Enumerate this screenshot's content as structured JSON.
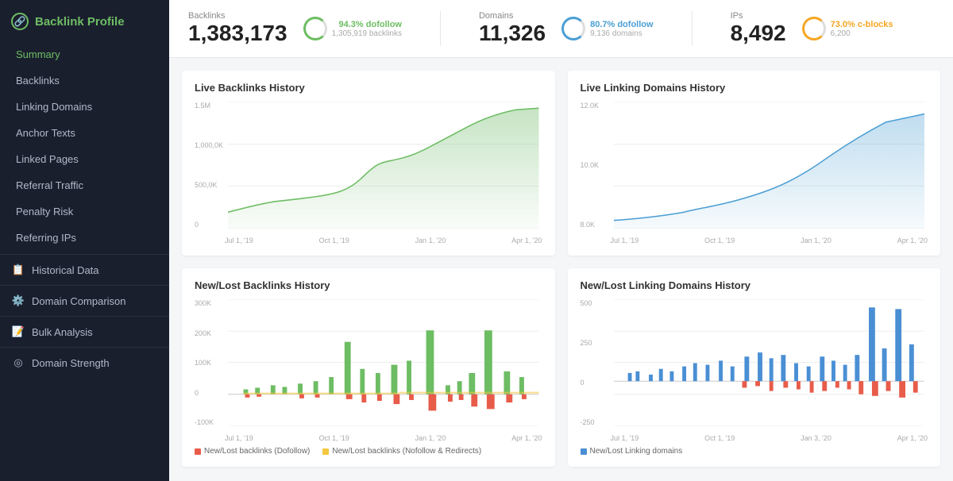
{
  "sidebar": {
    "logo_text": "Backlink Profile",
    "items": [
      {
        "label": "Summary",
        "active": true
      },
      {
        "label": "Backlinks",
        "active": false
      },
      {
        "label": "Linking Domains",
        "active": false
      },
      {
        "label": "Anchor Texts",
        "active": false
      },
      {
        "label": "Linked Pages",
        "active": false
      },
      {
        "label": "Referral Traffic",
        "active": false
      },
      {
        "label": "Penalty Risk",
        "active": false
      },
      {
        "label": "Referring IPs",
        "active": false
      }
    ],
    "sections": [
      {
        "label": "Historical Data",
        "icon": "📋"
      },
      {
        "label": "Domain Comparison",
        "icon": "⚙"
      },
      {
        "label": "Bulk Analysis",
        "icon": "📝"
      },
      {
        "label": "Domain Strength",
        "icon": "◎"
      }
    ]
  },
  "stats": {
    "backlinks": {
      "label": "Backlinks",
      "value": "1,383,173",
      "badge": "94.3% dofollow",
      "subtext": "1,305,919 backlinks",
      "circle_color": "green"
    },
    "domains": {
      "label": "Domains",
      "value": "11,326",
      "badge": "80.7% dofollow",
      "subtext": "9,136 domains",
      "circle_color": "blue"
    },
    "ips": {
      "label": "IPs",
      "value": "8,492",
      "badge": "73.0% c-blocks",
      "subtext": "6,200",
      "circle_color": "orange"
    }
  },
  "charts": {
    "live_backlinks": {
      "title": "Live Backlinks History",
      "y_labels": [
        "1.5M",
        "1,000,0K",
        "500,0K",
        "0"
      ],
      "x_labels": [
        "Jul 1, '19",
        "Oct 1, '19",
        "Jan 1, '20",
        "Apr 1, '20"
      ]
    },
    "live_domains": {
      "title": "Live Linking Domains History",
      "y_labels": [
        "12.0K",
        "10.0K",
        "8.0K"
      ],
      "x_labels": [
        "Jul 1, '19",
        "Oct 1, '19",
        "Jan 1, '20",
        "Apr 1, '20"
      ]
    },
    "new_lost_backlinks": {
      "title": "New/Lost Backlinks History",
      "y_labels": [
        "300K",
        "200K",
        "100K",
        "0",
        "-100K"
      ],
      "x_labels": [
        "Jul 1, '19",
        "Oct 1, '19",
        "Jan 1, '20",
        "Apr 1, '20"
      ],
      "legend": [
        {
          "color": "#e85c4a",
          "label": "New/Lost backlinks (Dofollow)"
        },
        {
          "color": "#f5c842",
          "label": "New/Lost backlinks (Nofollow & Redirects)"
        }
      ]
    },
    "new_lost_domains": {
      "title": "New/Lost Linking Domains History",
      "y_labels": [
        "500",
        "250",
        "0",
        "-250"
      ],
      "x_labels": [
        "Jul 1, '19",
        "Oct 1, '19",
        "Jan 3, '20",
        "Apr 1, '20"
      ],
      "legend": [
        {
          "color": "#4a8fd4",
          "label": "New/Lost Linking domains"
        }
      ]
    }
  }
}
